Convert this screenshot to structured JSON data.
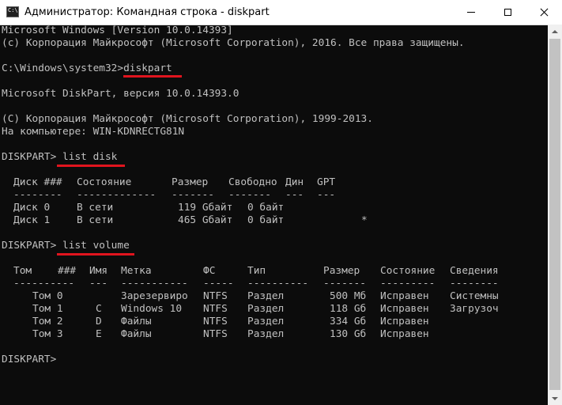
{
  "window": {
    "title": "Администратор: Командная строка - diskpart",
    "icon": "cmd-icon",
    "controls": [
      "minimize-icon",
      "maximize-icon",
      "close-icon"
    ]
  },
  "console": {
    "header_lines": [
      "Microsoft Windows [Version 10.0.14393]",
      "(c) Корпорация Майкрософт (Microsoft Corporation), 2016. Все права защищены.",
      "",
      "C:\\Windows\\system32>diskpart",
      "",
      "Microsoft DiskPart, версия 10.0.14393.0",
      "",
      "(C) Корпорация Майкрософт (Microsoft Corporation), 1999-2013.",
      "На компьютере: WIN-KDNRECTG81N",
      "",
      "DISKPART> list disk"
    ],
    "disk_table": {
      "headers": [
        "Диск ###",
        "Состояние",
        "Размер",
        "Свободно",
        "Дин",
        "GPT"
      ],
      "dashes": [
        "--------",
        "-------------",
        "-------",
        "-------",
        "---",
        "---"
      ],
      "rows": [
        [
          "Диск 0",
          "В сети",
          "119 Gбайт",
          "0 байт",
          "",
          ""
        ],
        [
          "Диск 1",
          "В сети",
          "465 Gбайт",
          "0 байт",
          "",
          "*"
        ]
      ]
    },
    "list_volume_cmd": "DISKPART> list volume",
    "volume_table": {
      "headers": [
        "Том",
        "###",
        "Имя",
        "Метка",
        "ФС",
        "Тип",
        "Размер",
        "Состояние",
        "Сведения"
      ],
      "dashes": [
        "----------",
        "---",
        "-----------",
        "-----",
        "----------",
        "-------",
        "---------",
        "--------"
      ],
      "rows": [
        [
          "Том 0",
          "",
          "Зарезервиро",
          "NTFS",
          "Раздел",
          "500 Мб",
          "Исправен",
          "Системны"
        ],
        [
          "Том 1",
          "C",
          "Windows 10",
          "NTFS",
          "Раздел",
          "118 Gб",
          "Исправен",
          "Загрузоч"
        ],
        [
          "Том 2",
          "D",
          "Файлы",
          "NTFS",
          "Раздел",
          "334 Gб",
          "Исправен",
          ""
        ],
        [
          "Том 3",
          "E",
          "Файлы",
          "NTFS",
          "Раздел",
          "130 Gб",
          "Исправен",
          ""
        ]
      ]
    },
    "prompt": "DISKPART>"
  },
  "colors": {
    "console_bg": "#0c0c0c",
    "console_text": "#c0c0c0",
    "highlight_underline": "#e0141e"
  }
}
